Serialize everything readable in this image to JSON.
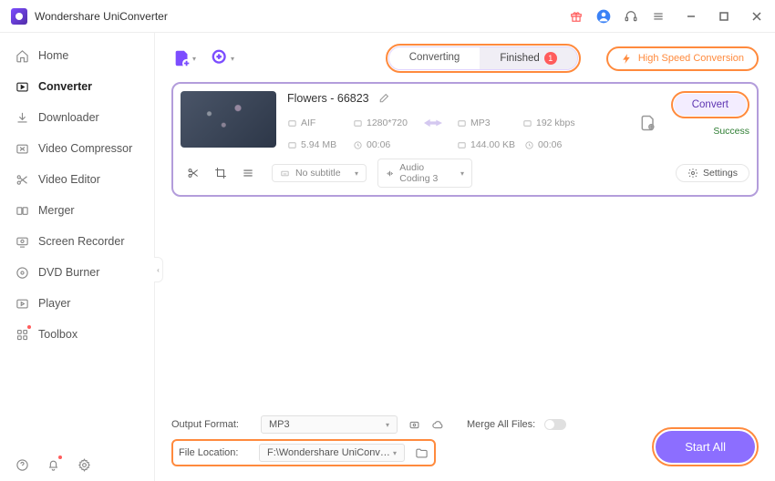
{
  "app_title": "Wondershare UniConverter",
  "sidebar": {
    "items": [
      {
        "label": "Home"
      },
      {
        "label": "Converter"
      },
      {
        "label": "Downloader"
      },
      {
        "label": "Video Compressor"
      },
      {
        "label": "Video Editor"
      },
      {
        "label": "Merger"
      },
      {
        "label": "Screen Recorder"
      },
      {
        "label": "DVD Burner"
      },
      {
        "label": "Player"
      },
      {
        "label": "Toolbox"
      }
    ]
  },
  "tabs": {
    "converting": "Converting",
    "finished": "Finished",
    "badge_count": "1"
  },
  "high_speed_label": "High Speed Conversion",
  "item": {
    "filename": "Flowers - 66823",
    "src": {
      "format": "AIF",
      "resolution": "1280*720",
      "size": "5.94 MB",
      "duration": "00:06"
    },
    "dst": {
      "format": "MP3",
      "bitrate": "192 kbps",
      "size": "144.00 KB",
      "duration": "00:06"
    },
    "subtitle": "No subtitle",
    "audio_track": "Audio Coding 3",
    "settings_label": "Settings",
    "convert_label": "Convert",
    "status": "Success"
  },
  "bottom": {
    "output_format_label": "Output Format:",
    "output_format_value": "MP3",
    "merge_label": "Merge All Files:",
    "file_location_label": "File Location:",
    "file_location_value": "F:\\Wondershare UniConverter",
    "start_all": "Start All"
  }
}
